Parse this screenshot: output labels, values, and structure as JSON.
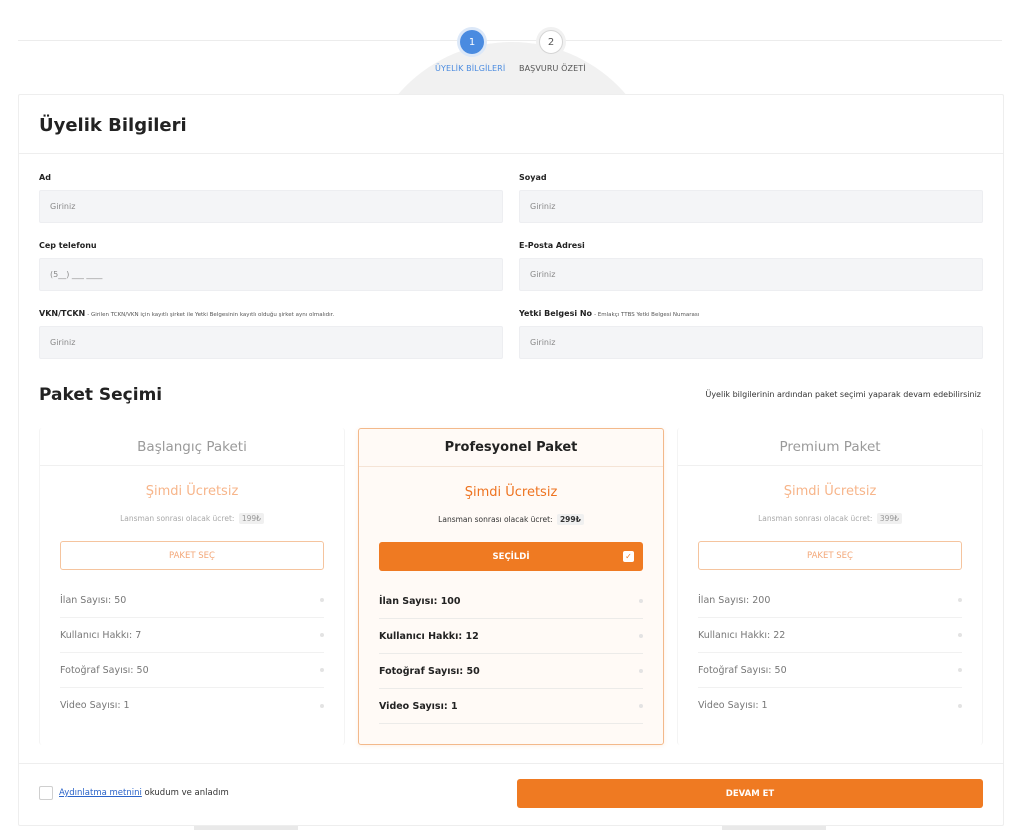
{
  "stepper": {
    "steps": [
      {
        "number": "1",
        "label": "ÜYELİK BİLGİLERİ"
      },
      {
        "number": "2",
        "label": "BAŞVURU ÖZETİ"
      }
    ],
    "active_color": "#4a8be0"
  },
  "form": {
    "title": "Üyelik Bilgileri",
    "fields": {
      "ad": {
        "label": "Ad",
        "placeholder": "Giriniz"
      },
      "soyad": {
        "label": "Soyad",
        "placeholder": "Giriniz"
      },
      "cep": {
        "label": "Cep telefonu",
        "placeholder": "(5__) ___ ____"
      },
      "email": {
        "label": "E-Posta Adresi",
        "placeholder": "Giriniz"
      },
      "vkn": {
        "label": "VKN/TCKN",
        "hint": "- Girilen TCKN/VKN için kayıtlı şirket ile Yetki Belgesinin kayıtlı olduğu şirket aynı olmalıdır.",
        "placeholder": "Giriniz"
      },
      "yetki": {
        "label": "Yetki Belgesi No",
        "hint": "- Emlakçı TTBS Yetki Belgesi Numarası",
        "placeholder": "Giriniz"
      }
    }
  },
  "packages": {
    "title": "Paket Seçimi",
    "note": "Üyelik bilgilerinin ardından paket seçimi yaparak devam edebilirsiniz",
    "accent_color": "#ef7a22",
    "items": [
      {
        "name": "Başlangıç Paketi",
        "free_text": "Şimdi Ücretsiz",
        "price_label": "Lansman sonrası olacak ücret:",
        "price": "199₺",
        "button": "PAKET SEÇ",
        "selected": false,
        "features": [
          "İlan Sayısı: 50",
          "Kullanıcı Hakkı: 7",
          "Fotoğraf Sayısı: 50",
          "Video Sayısı: 1"
        ]
      },
      {
        "name": "Profesyonel Paket",
        "free_text": "Şimdi Ücretsiz",
        "price_label": "Lansman sonrası olacak ücret:",
        "price": "299₺",
        "button": "SEÇİLDİ",
        "selected": true,
        "features": [
          "İlan Sayısı: 100",
          "Kullanıcı Hakkı: 12",
          "Fotoğraf Sayısı: 50",
          "Video Sayısı: 1"
        ]
      },
      {
        "name": "Premium Paket",
        "free_text": "Şimdi Ücretsiz",
        "price_label": "Lansman sonrası olacak ücret:",
        "price": "399₺",
        "button": "PAKET SEÇ",
        "selected": false,
        "features": [
          "İlan Sayısı: 200",
          "Kullanıcı Hakkı: 22",
          "Fotoğraf Sayısı: 50",
          "Video Sayısı: 1"
        ]
      }
    ]
  },
  "footer": {
    "consent_link": "Aydınlatma metnini",
    "consent_rest": " okudum ve anladım",
    "continue": "DEVAM ET"
  }
}
